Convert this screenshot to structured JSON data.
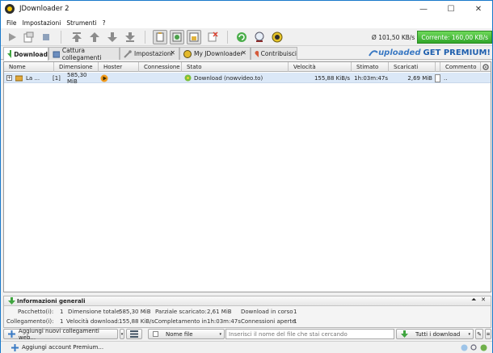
{
  "window": {
    "title": "JDownloader 2",
    "minimize": "—",
    "maximize": "☐",
    "close": "✕"
  },
  "menu": [
    "File",
    "Impostazioni",
    "Strumenti",
    "?"
  ],
  "speed": {
    "average": "Ø 101,50 KB/s",
    "current": "Corrente: 160,00 KB/s"
  },
  "tabs": [
    {
      "label": "Download"
    },
    {
      "label": "Cattura collegamenti"
    },
    {
      "label": "Impostazioni",
      "close": "✕"
    },
    {
      "label": "My JDownloader",
      "close": "✕"
    },
    {
      "label": "Contribuisci"
    }
  ],
  "promo": {
    "brand": "uploaded",
    "cta": "GET PREMIUM!"
  },
  "table": {
    "columns": [
      "Nome",
      "Dimensione",
      "Hoster",
      "Connessione",
      "Stato",
      "Velocità",
      "Stimato",
      "Scaricati",
      "Commento"
    ],
    "rows": [
      {
        "expand": "+",
        "name": "La ...",
        "count": "[1]",
        "size": "585,30 MiB",
        "status": "Download (nowvideo.to)",
        "speed": "155,88 KiB/s",
        "eta": "1h:03m:47s",
        "downloaded": "2,69 MiB",
        "comment": ".."
      }
    ]
  },
  "info": {
    "title": "Informazioni generali",
    "labels": {
      "packages": "Pacchetto(i):",
      "links": "Collegamento(i):",
      "total_size": "Dimensione totale:",
      "download_speed": "Velocità download:",
      "partial": "Parziale scaricato:",
      "completion": "Completamento in",
      "in_progress": "Download in corso",
      "connections": "Connessioni aperte"
    },
    "values": {
      "packages": "1",
      "links": "1",
      "total_size": "585,30 MiB",
      "download_speed": "155,88 KiB/s",
      "partial": "2,61 MiB",
      "completion": "1h:03m:47s",
      "in_progress": "1",
      "connections": "1"
    }
  },
  "bottom": {
    "add_links": "Aggiungi nuovi collegamenti web...",
    "filter_field": "Nome file",
    "search_placeholder": "Inserisci il nome del file che stai cercando",
    "all_downloads": "Tutti i download"
  },
  "status": {
    "add_account": "Aggiungi account Premium..."
  }
}
